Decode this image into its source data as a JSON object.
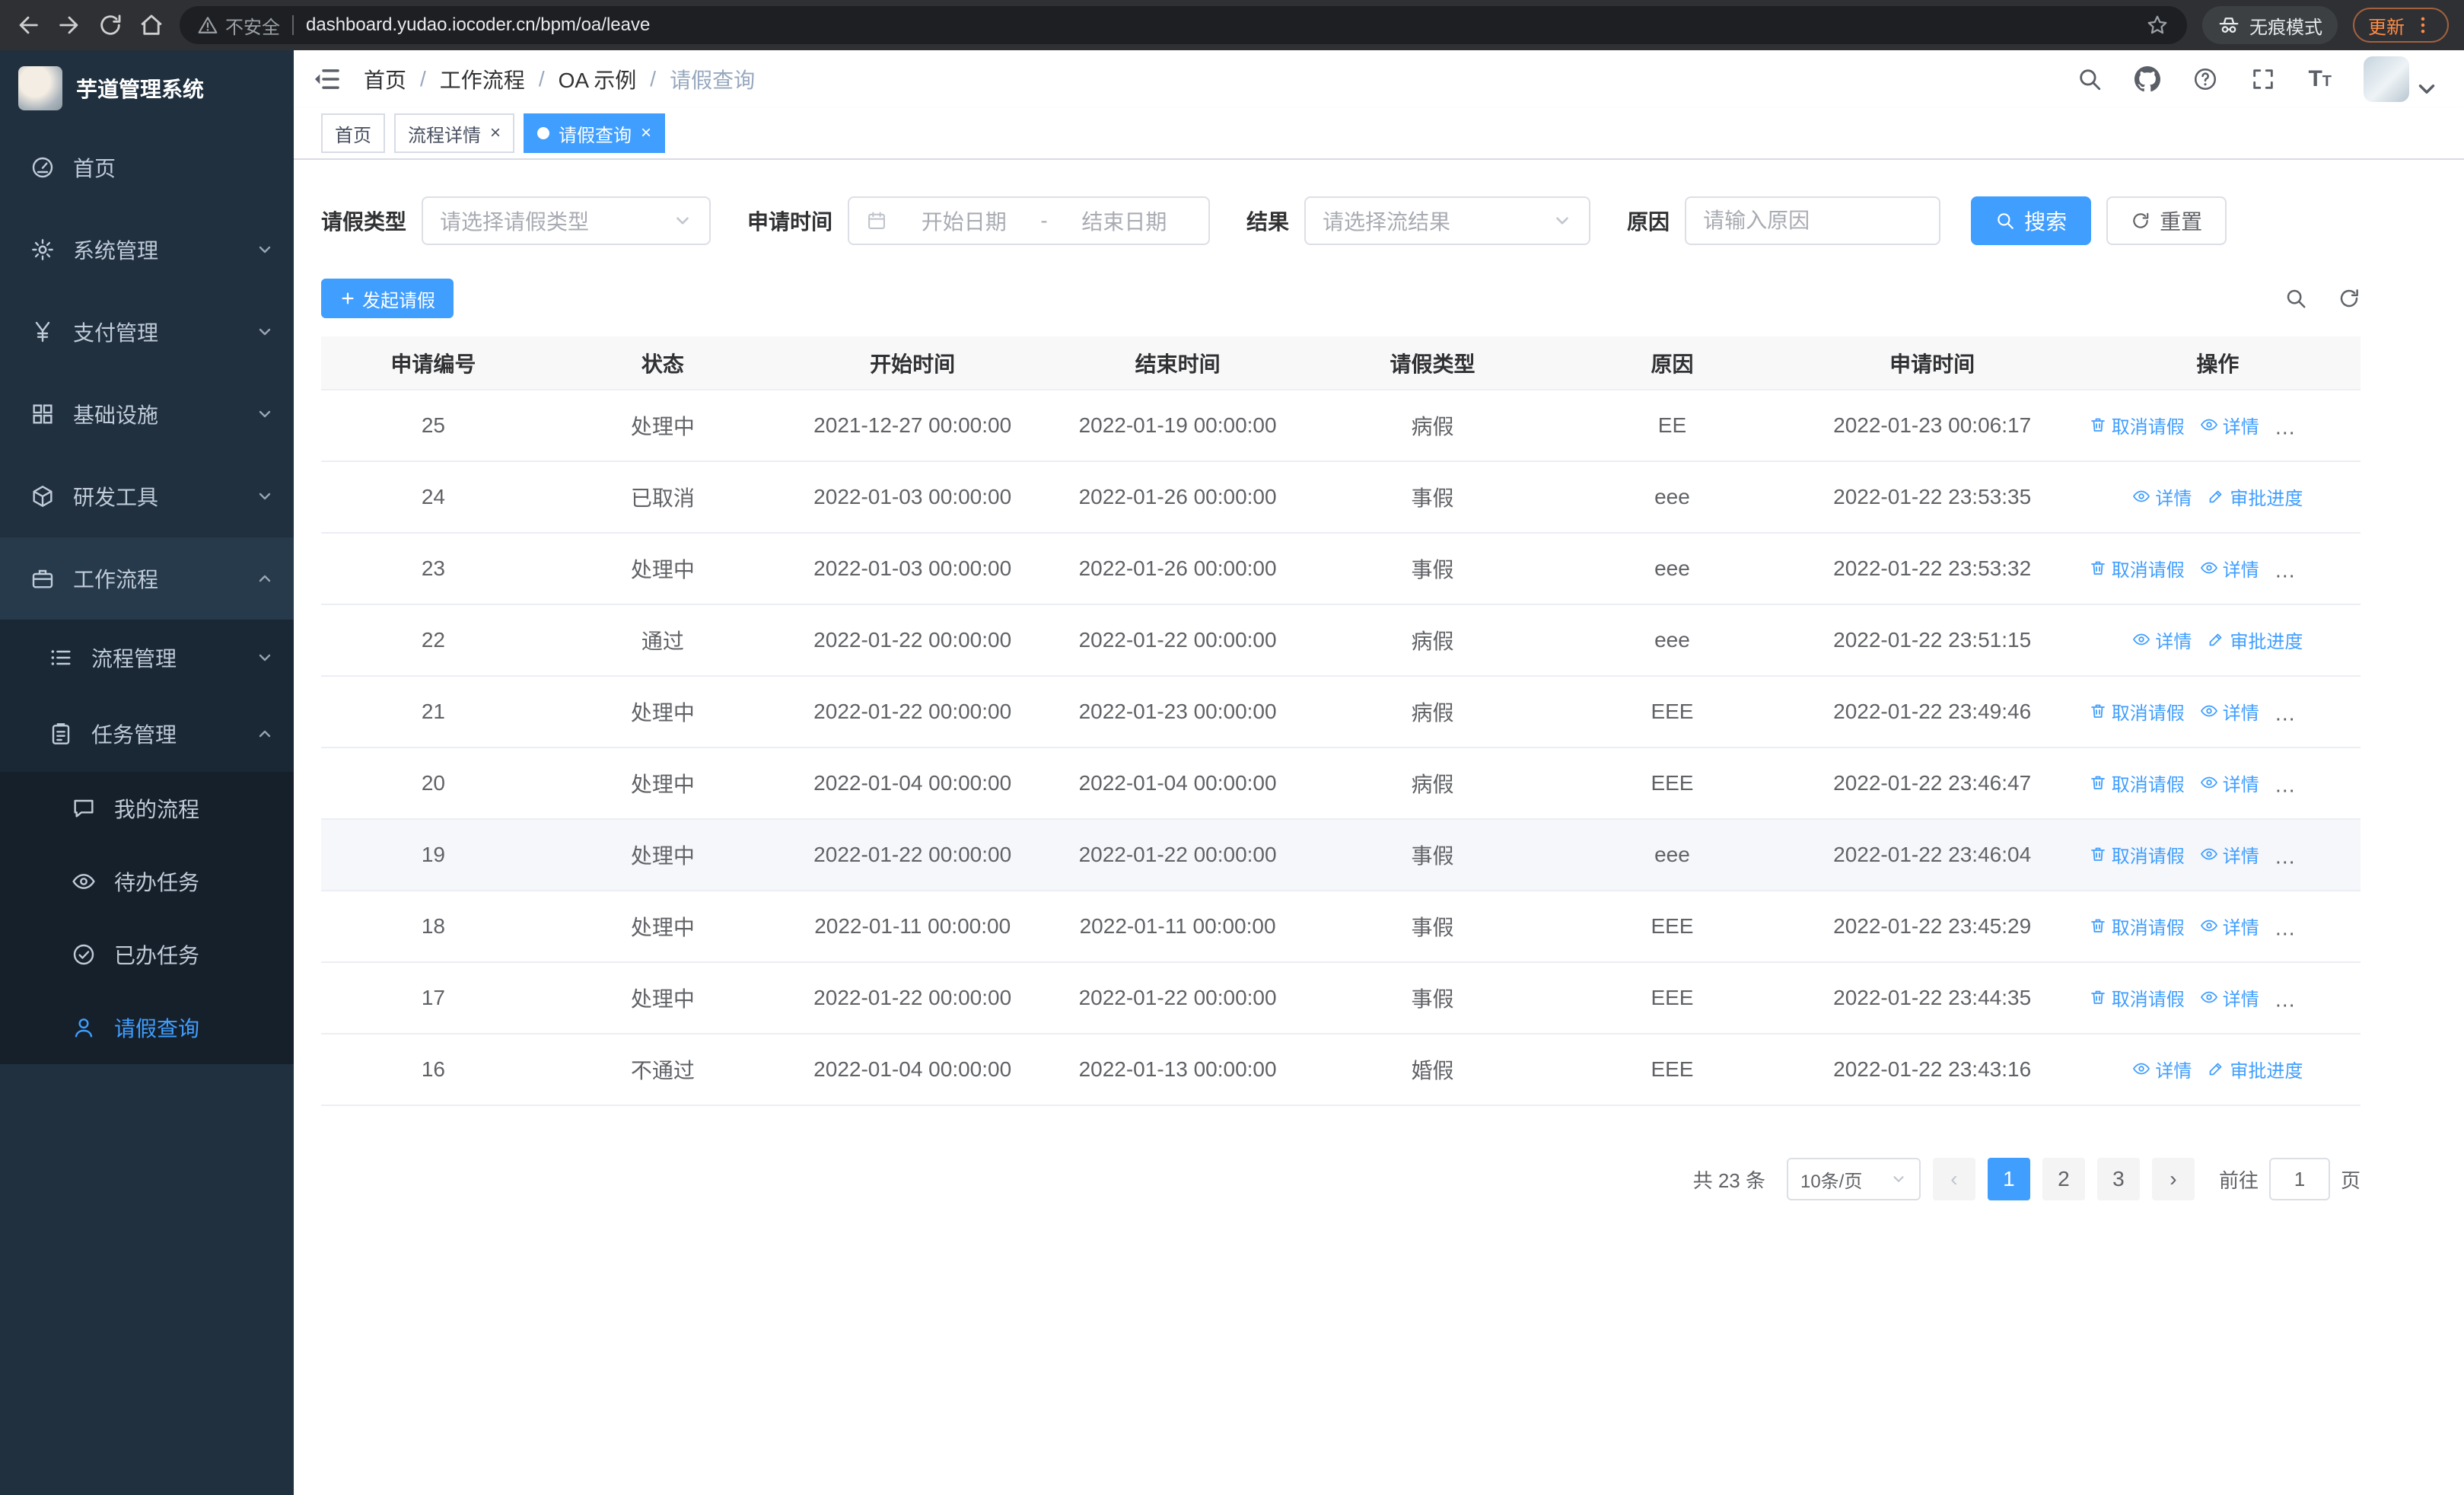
{
  "browser": {
    "security_label": "不安全",
    "url": "dashboard.yudao.iocoder.cn/bpm/oa/leave",
    "incognito_label": "无痕模式",
    "update_label": "更新"
  },
  "sidebar": {
    "logo_title": "芋道管理系统",
    "items": {
      "home": "首页",
      "system": "系统管理",
      "pay": "支付管理",
      "infra": "基础设施",
      "dev": "研发工具",
      "workflow": "工作流程",
      "process": "流程管理",
      "task": "任务管理",
      "my_process": "我的流程",
      "todo": "待办任务",
      "done": "已办任务",
      "leave": "请假查询"
    }
  },
  "header": {
    "breadcrumb": [
      "首页",
      "工作流程",
      "OA 示例",
      "请假查询"
    ]
  },
  "tabs": {
    "t0": "首页",
    "t1": "流程详情",
    "t2": "请假查询"
  },
  "filters": {
    "type_label": "请假类型",
    "type_placeholder": "请选择请假类型",
    "time_label": "申请时间",
    "start_placeholder": "开始日期",
    "range_separator": "-",
    "end_placeholder": "结束日期",
    "result_label": "结果",
    "result_placeholder": "请选择流结果",
    "reason_label": "原因",
    "reason_placeholder": "请输入原因",
    "search_label": "搜索",
    "reset_label": "重置"
  },
  "toolbar": {
    "create_label": "发起请假"
  },
  "table": {
    "columns": [
      "申请编号",
      "状态",
      "开始时间",
      "结束时间",
      "请假类型",
      "原因",
      "申请时间",
      "操作"
    ],
    "action_labels": {
      "cancel": "取消请假",
      "detail": "详情",
      "progress": "审批进度"
    },
    "rows": [
      {
        "id": "25",
        "status": "处理中",
        "start": "2021-12-27 00:00:00",
        "end": "2022-01-19 00:00:00",
        "type": "病假",
        "reason": "EE",
        "applied": "2022-01-23 00:06:17",
        "can_cancel": true,
        "highlighted": false
      },
      {
        "id": "24",
        "status": "已取消",
        "start": "2022-01-03 00:00:00",
        "end": "2022-01-26 00:00:00",
        "type": "事假",
        "reason": "eee",
        "applied": "2022-01-22 23:53:35",
        "can_cancel": false,
        "highlighted": false
      },
      {
        "id": "23",
        "status": "处理中",
        "start": "2022-01-03 00:00:00",
        "end": "2022-01-26 00:00:00",
        "type": "事假",
        "reason": "eee",
        "applied": "2022-01-22 23:53:32",
        "can_cancel": true,
        "highlighted": false
      },
      {
        "id": "22",
        "status": "通过",
        "start": "2022-01-22 00:00:00",
        "end": "2022-01-22 00:00:00",
        "type": "病假",
        "reason": "eee",
        "applied": "2022-01-22 23:51:15",
        "can_cancel": false,
        "highlighted": false
      },
      {
        "id": "21",
        "status": "处理中",
        "start": "2022-01-22 00:00:00",
        "end": "2022-01-23 00:00:00",
        "type": "病假",
        "reason": "EEE",
        "applied": "2022-01-22 23:49:46",
        "can_cancel": true,
        "highlighted": false
      },
      {
        "id": "20",
        "status": "处理中",
        "start": "2022-01-04 00:00:00",
        "end": "2022-01-04 00:00:00",
        "type": "病假",
        "reason": "EEE",
        "applied": "2022-01-22 23:46:47",
        "can_cancel": true,
        "highlighted": false
      },
      {
        "id": "19",
        "status": "处理中",
        "start": "2022-01-22 00:00:00",
        "end": "2022-01-22 00:00:00",
        "type": "事假",
        "reason": "eee",
        "applied": "2022-01-22 23:46:04",
        "can_cancel": true,
        "highlighted": true
      },
      {
        "id": "18",
        "status": "处理中",
        "start": "2022-01-11 00:00:00",
        "end": "2022-01-11 00:00:00",
        "type": "事假",
        "reason": "EEE",
        "applied": "2022-01-22 23:45:29",
        "can_cancel": true,
        "highlighted": false
      },
      {
        "id": "17",
        "status": "处理中",
        "start": "2022-01-22 00:00:00",
        "end": "2022-01-22 00:00:00",
        "type": "事假",
        "reason": "EEE",
        "applied": "2022-01-22 23:44:35",
        "can_cancel": true,
        "highlighted": false
      },
      {
        "id": "16",
        "status": "不通过",
        "start": "2022-01-04 00:00:00",
        "end": "2022-01-13 00:00:00",
        "type": "婚假",
        "reason": "EEE",
        "applied": "2022-01-22 23:43:16",
        "can_cancel": false,
        "highlighted": false
      }
    ]
  },
  "pagination": {
    "total": "共 23 条",
    "page_size": "10条/页",
    "prev": "‹",
    "next": "›",
    "pages": [
      "1",
      "2",
      "3"
    ],
    "current": "1",
    "goto_label": "前往",
    "goto_value": "1",
    "unit_label": "页"
  },
  "colors": {
    "primary": "#409EFF",
    "sidebar_bg": "#20303f"
  }
}
